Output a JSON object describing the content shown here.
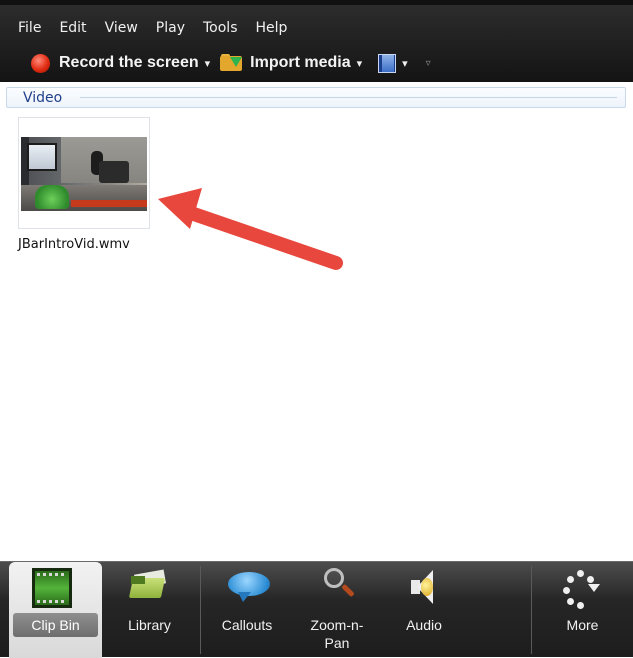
{
  "menubar": {
    "items": [
      "File",
      "Edit",
      "View",
      "Play",
      "Tools",
      "Help"
    ]
  },
  "toolbar": {
    "record_label": "Record the screen",
    "import_label": "Import media",
    "record_icon": "record-dot-icon",
    "import_icon": "folder-import-icon",
    "produce_icon": "film-produce-icon",
    "dropdown_caret": "▾",
    "overflow": "▿"
  },
  "section": {
    "title": "Video"
  },
  "clip": {
    "file_name": "JBarIntroVid.wmv",
    "thumbnail_icon": "video-thumbnail"
  },
  "annotation": {
    "arrow_color": "#e8473d"
  },
  "tabs": [
    {
      "label": "Clip Bin",
      "icon": "clip-bin-icon",
      "active": true
    },
    {
      "label": "Library",
      "icon": "library-icon",
      "active": false
    },
    {
      "label": "Callouts",
      "icon": "callouts-icon",
      "active": false
    },
    {
      "label": "Zoom-n-\nPan",
      "icon": "zoom-n-pan-icon",
      "active": false
    },
    {
      "label": "Audio",
      "icon": "audio-icon",
      "active": false
    },
    {
      "label": "More",
      "icon": "more-icon",
      "active": false
    }
  ]
}
